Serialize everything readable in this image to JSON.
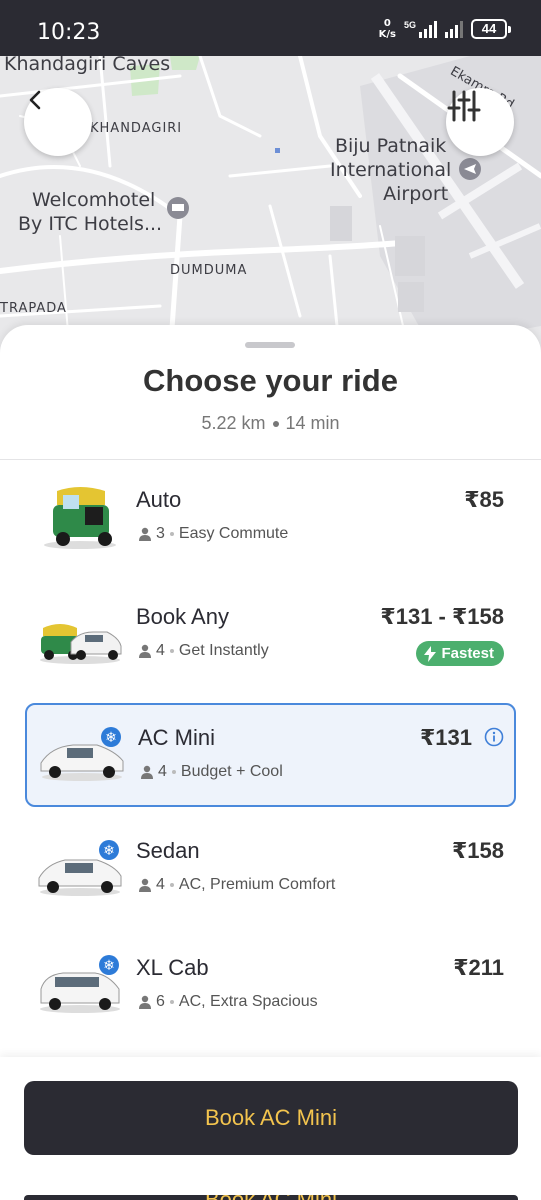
{
  "status_bar": {
    "time": "10:23",
    "net_speed_value": "0",
    "net_speed_unit": "K/s",
    "network_type": "5G",
    "battery": "44"
  },
  "map": {
    "labels": {
      "khandagiri_caves": "Khandagiri Caves",
      "khandagiri": "KHANDAGIRI",
      "biju_line1": "Biju Patnaik",
      "biju_line2": "International",
      "biju_line3": "Airport",
      "welcom_line1": "Welcomhotel",
      "welcom_line2": "By ITC Hotels...",
      "dumduma": "DUMDUMA",
      "trapada": "TRAPADA",
      "ekamra": "Ekamra Rd"
    },
    "back_icon": "chevron-left-icon",
    "filter_icon": "sliders-icon"
  },
  "sheet": {
    "title": "Choose your ride",
    "distance": "5.22 km",
    "duration": "14 min"
  },
  "rides": [
    {
      "name": "Auto",
      "seats": "3",
      "tagline": "Easy Commute",
      "price": "₹85",
      "icon": "auto-rickshaw-icon"
    },
    {
      "name": "Book Any",
      "seats": "4",
      "tagline": "Get Instantly",
      "price": "₹131 - ₹158",
      "badge": "Fastest",
      "icon": "auto-and-car-icon"
    },
    {
      "name": "AC Mini",
      "seats": "4",
      "tagline": "Budget + Cool",
      "price": "₹131",
      "selected": true,
      "icon": "car-ac-icon"
    },
    {
      "name": "Sedan",
      "seats": "4",
      "tagline": "AC, Premium Comfort",
      "price": "₹158",
      "icon": "car-ac-icon"
    },
    {
      "name": "XL Cab",
      "seats": "6",
      "tagline": "AC, Extra Spacious",
      "price": "₹211",
      "icon": "suv-ac-icon"
    }
  ],
  "cta": {
    "label": "Book AC Mini"
  },
  "colors": {
    "status_bar": "#2b2b33",
    "selected_border": "#4a89dc",
    "fastest_badge": "#4caf6e",
    "cta_bg": "#2b2b33",
    "cta_text": "#f3c44e"
  }
}
